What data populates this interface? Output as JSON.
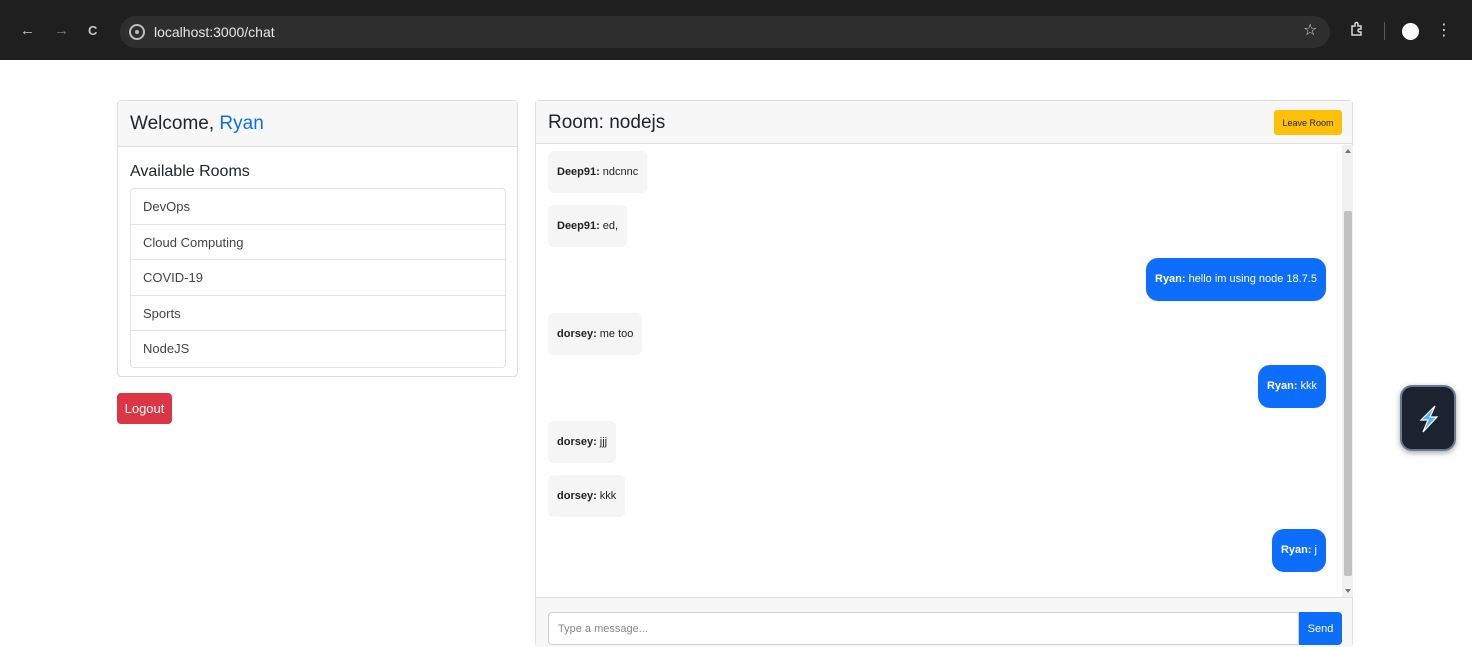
{
  "browser": {
    "url": "localhost:3000/chat",
    "back_icon": "←",
    "forward_icon": "→",
    "reload_icon": "C",
    "star_icon": "☆",
    "menu_icon": "⋮"
  },
  "sidebar": {
    "welcome_prefix": "Welcome, ",
    "username": "Ryan",
    "rooms_title": "Available Rooms",
    "rooms": [
      {
        "label": "DevOps"
      },
      {
        "label": "Cloud Computing"
      },
      {
        "label": "COVID-19"
      },
      {
        "label": "Sports"
      },
      {
        "label": "NodeJS"
      }
    ],
    "logout_label": "Logout"
  },
  "chat": {
    "room_title": "Room: nodejs",
    "leave_label": "Leave Room",
    "messages": [
      {
        "user": "Deep91:",
        "text": "ndcnnc",
        "self": false
      },
      {
        "user": "Deep91:",
        "text": "ed,",
        "self": false
      },
      {
        "user": "Ryan:",
        "text": "hello im using node 18.7.5",
        "self": true
      },
      {
        "user": "dorsey:",
        "text": "me too",
        "self": false
      },
      {
        "user": "Ryan:",
        "text": "kkk",
        "self": true
      },
      {
        "user": "dorsey:",
        "text": "jjj",
        "self": false
      },
      {
        "user": "dorsey:",
        "text": "kkk",
        "self": false
      },
      {
        "user": "Ryan:",
        "text": "j",
        "self": true
      }
    ],
    "input_placeholder": "Type a message...",
    "send_label": "Send"
  },
  "colors": {
    "primary": "#0d6efd",
    "danger": "#dc3545",
    "warning": "#ffc107",
    "browser_bar": "#1f1f1f"
  }
}
